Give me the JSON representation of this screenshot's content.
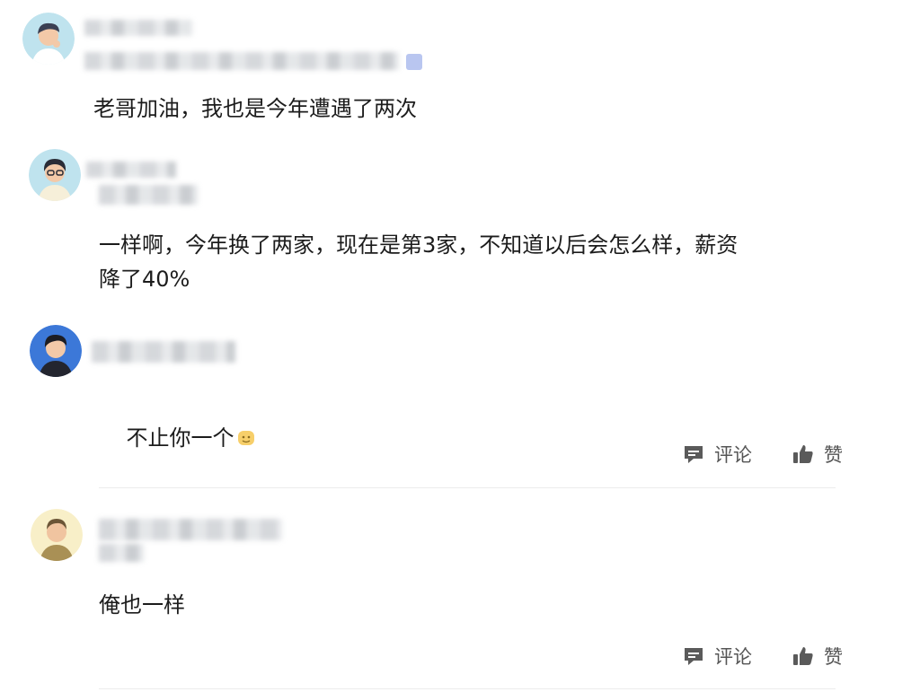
{
  "comments": [
    {
      "text": "老哥加油，我也是今年遭遇了两次",
      "avatar": "avatar-man-thinking"
    },
    {
      "text": "一样啊，今年换了两家，现在是第3家，不知道以后会怎么样，薪资\n降了40%",
      "avatar": "avatar-man-glasses"
    },
    {
      "text": "不止你一个",
      "emoji": "smiling-face-emoji",
      "avatar": "avatar-man-dark-hair",
      "actions": {
        "comment_label": "评论",
        "like_label": "赞"
      }
    },
    {
      "text": "俺也一样",
      "avatar": "avatar-man-beard",
      "actions": {
        "comment_label": "评论",
        "like_label": "赞"
      }
    }
  ],
  "colors": {
    "text": "#1c1c1c",
    "action_text": "#555555",
    "divider": "#ececec",
    "icon": "#5a5a5a"
  }
}
